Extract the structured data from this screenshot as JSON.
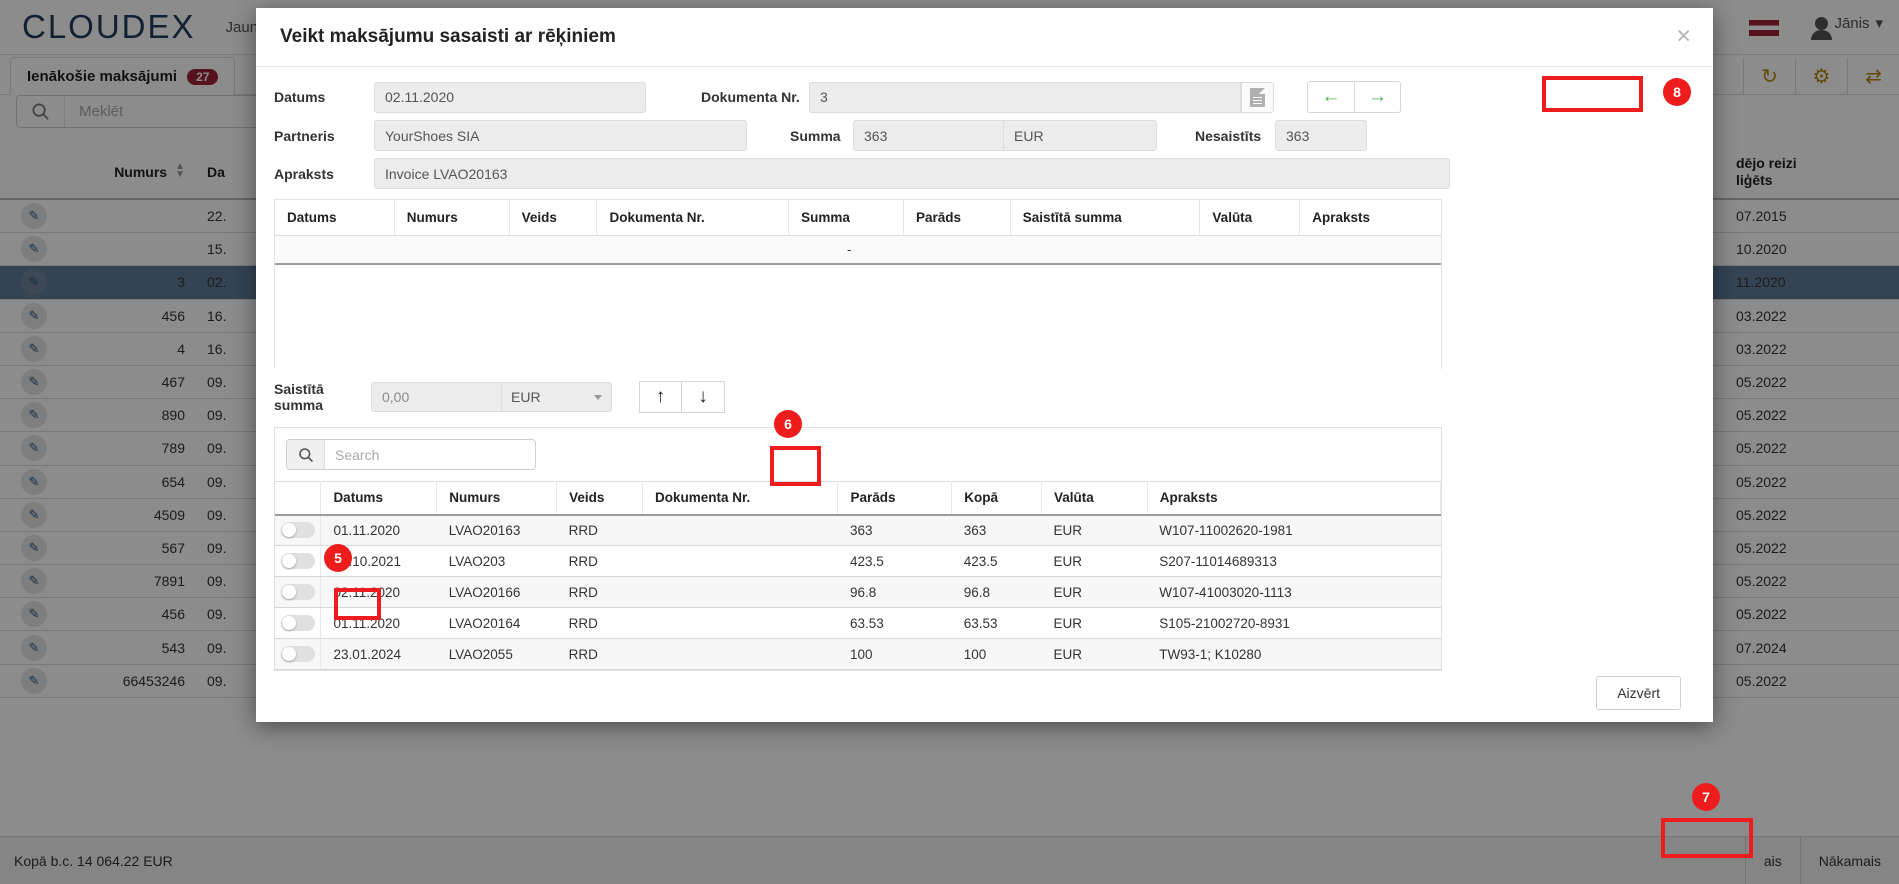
{
  "app": {
    "brand": "CLOUDEX",
    "nav_item": "Jauns",
    "nav_caret": "▾",
    "user": "Jānis",
    "user_caret": "▾",
    "tab_label": "Ienākošie maksājumi",
    "tab_count": "27",
    "search_placeholder": "Meklēt",
    "search_icon": "search-icon",
    "toolbar_icons": [
      "refresh-icon",
      "gear-icon",
      "transfer-icon"
    ],
    "toolbar_glyphs": [
      "↻",
      "⚙",
      "⇄"
    ],
    "accent_brand": "#1f3b5c",
    "accent_badge": "#9d2235",
    "accent_highlight": "#ee1c1c",
    "accent_green": "#4caf50"
  },
  "bg_table": {
    "headers": {
      "numurs": "Numurs",
      "datums": "Da",
      "last_paid": "dējo reizi\nliGēts",
      "last_paid_l1": "dējo reizi",
      "last_paid_l2": "liģēts"
    },
    "rows": [
      {
        "numurs": "",
        "datums": "22.",
        "last": "07.2015",
        "selected": false
      },
      {
        "numurs": "",
        "datums": "15.",
        "last": "10.2020",
        "selected": false
      },
      {
        "numurs": "3",
        "datums": "02.",
        "last": "11.2020",
        "selected": true
      },
      {
        "numurs": "456",
        "datums": "16.",
        "last": "03.2022",
        "selected": false
      },
      {
        "numurs": "4",
        "datums": "16.",
        "last": "03.2022",
        "selected": false
      },
      {
        "numurs": "467",
        "datums": "09.",
        "last": "05.2022",
        "selected": false
      },
      {
        "numurs": "890",
        "datums": "09.",
        "last": "05.2022",
        "selected": false
      },
      {
        "numurs": "789",
        "datums": "09.",
        "last": "05.2022",
        "selected": false
      },
      {
        "numurs": "654",
        "datums": "09.",
        "last": "05.2022",
        "selected": false
      },
      {
        "numurs": "4509",
        "datums": "09.",
        "last": "05.2022",
        "selected": false
      },
      {
        "numurs": "567",
        "datums": "09.",
        "last": "05.2022",
        "selected": false
      },
      {
        "numurs": "7891",
        "datums": "09.",
        "last": "05.2022",
        "selected": false
      },
      {
        "numurs": "456",
        "datums": "09.",
        "last": "05.2022",
        "selected": false
      },
      {
        "numurs": "543",
        "datums": "09.",
        "last": "07.2024",
        "selected": false
      },
      {
        "numurs": "66453246",
        "datums": "09.",
        "last": "05.2022",
        "selected": false
      }
    ],
    "footer_total": "Kopā b.c. 14 064.22 EUR",
    "pager_prev": "ais",
    "pager_next": "Nākamais"
  },
  "modal": {
    "title": "Veikt maksājumu sasaisti ar rēķiniem",
    "close_icon": "×",
    "form": {
      "datums_label": "Datums",
      "datums_value": "02.11.2020",
      "dokumenta_nr_label": "Dokumenta Nr.",
      "dokumenta_nr_value": "3",
      "doc_button_icon": "document-icon",
      "partneris_label": "Partneris",
      "partneris_value": "YourShoes SIA",
      "summa_label": "Summa",
      "summa_value": "363",
      "summa_currency": "EUR",
      "nesaistits_label": "Nesaistīts",
      "nesaistits_value": "363",
      "apraksts_label": "Apraksts",
      "apraksts_value": "Invoice LVAO20163",
      "nav_prev_icon": "←",
      "nav_next_icon": "→"
    },
    "linked_table": {
      "headers": [
        "Datums",
        "Numurs",
        "Veids",
        "Dokumenta Nr.",
        "Summa",
        "Parāds",
        "Saistītā summa",
        "Valūta",
        "Apraksts"
      ],
      "summary_dash": "-",
      "rows": []
    },
    "link_amount": {
      "label": "Saistītā summa",
      "value": "0,00",
      "placeholder": "0,00",
      "currency": "EUR",
      "up_icon": "↑",
      "down_icon": "↓"
    },
    "invoice_table": {
      "search_placeholder": "Search",
      "search_icon": "search-icon",
      "headers": [
        "",
        "Datums",
        "Numurs",
        "Veids",
        "Dokumenta Nr.",
        "Parāds",
        "Kopā",
        "Valūta",
        "Apraksts"
      ],
      "rows": [
        {
          "datums": "01.11.2020",
          "numurs": "LVAO20163",
          "veids": "RRD",
          "dok": "",
          "parads": "363",
          "kopa": "363",
          "valuta": "EUR",
          "apraksts": "W107-11002620-1981"
        },
        {
          "datums": "28.10.2021",
          "numurs": "LVAO203",
          "veids": "RRD",
          "dok": "",
          "parads": "423.5",
          "kopa": "423.5",
          "valuta": "EUR",
          "apraksts": "S207-11014689313"
        },
        {
          "datums": "02.11.2020",
          "numurs": "LVAO20166",
          "veids": "RRD",
          "dok": "",
          "parads": "96.8",
          "kopa": "96.8",
          "valuta": "EUR",
          "apraksts": "W107-41003020-1113"
        },
        {
          "datums": "01.11.2020",
          "numurs": "LVAO20164",
          "veids": "RRD",
          "dok": "",
          "parads": "63.53",
          "kopa": "63.53",
          "valuta": "EUR",
          "apraksts": "S105-21002720-8931"
        },
        {
          "datums": "23.01.2024",
          "numurs": "LVAO2055",
          "veids": "RRD",
          "dok": "",
          "parads": "100",
          "kopa": "100",
          "valuta": "EUR",
          "apraksts": "TW93-1; K10280"
        }
      ]
    },
    "close_button": "Aizvērt"
  },
  "annotations": {
    "badge5": "5",
    "badge6": "6",
    "badge7": "7",
    "badge8": "8"
  }
}
